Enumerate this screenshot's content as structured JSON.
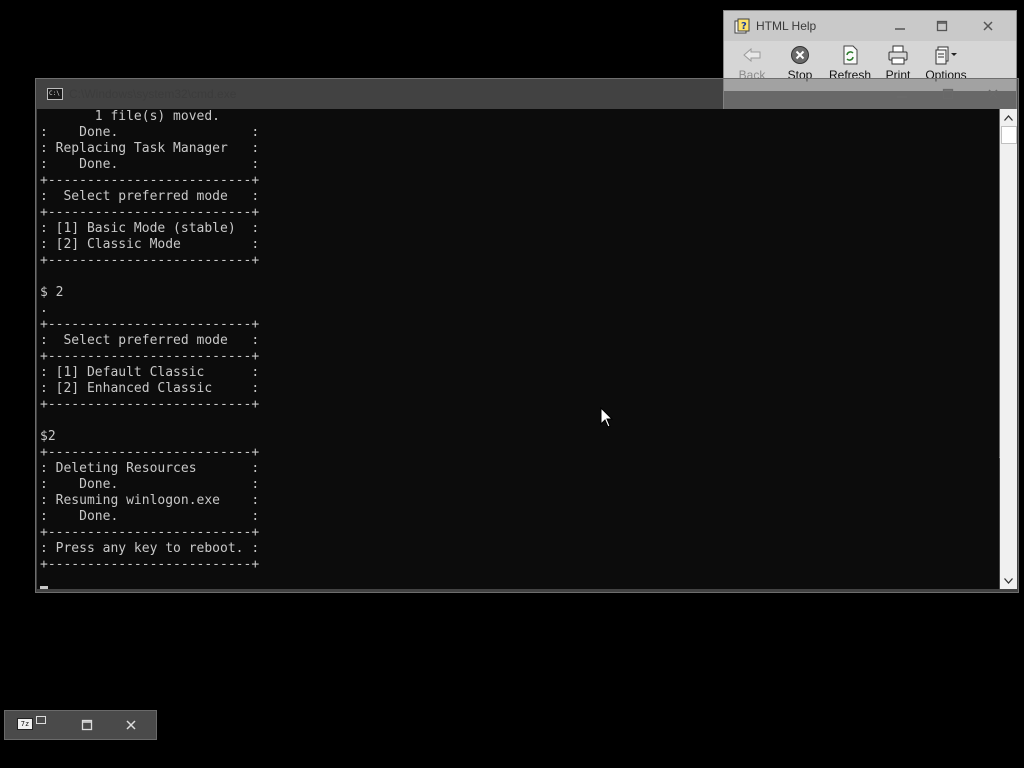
{
  "help_window": {
    "title": "HTML Help",
    "toolbar": [
      {
        "label": "Back",
        "icon": "back-arrow-icon",
        "enabled": false
      },
      {
        "label": "Stop",
        "icon": "stop-icon",
        "enabled": true
      },
      {
        "label": "Refresh",
        "icon": "refresh-icon",
        "enabled": true
      },
      {
        "label": "Print",
        "icon": "print-icon",
        "enabled": true
      },
      {
        "label": "Options",
        "icon": "options-icon",
        "enabled": true
      }
    ]
  },
  "cmd_window": {
    "title": "C:\\Windows\\system32\\cmd.exe",
    "console_lines": [
      "       1 file(s) moved.",
      ":    Done.                 :",
      ": Replacing Task Manager   :",
      ":    Done.                 :",
      "+--------------------------+",
      ":  Select preferred mode   :",
      "+--------------------------+",
      ": [1] Basic Mode (stable)  :",
      ": [2] Classic Mode         :",
      "+--------------------------+",
      "",
      "$ 2",
      ".",
      "+--------------------------+",
      ":  Select preferred mode   :",
      "+--------------------------+",
      ": [1] Default Classic      :",
      ": [2] Enhanced Classic     :",
      "+--------------------------+",
      "",
      "$2",
      "+--------------------------+",
      ": Deleting Resources       :",
      ":    Done.                 :",
      ": Resuming winlogon.exe    :",
      ":    Done.                 :",
      "+--------------------------+",
      ": Press any key to reboot. :",
      "+--------------------------+"
    ]
  },
  "colors": {
    "desktop": "#000000",
    "console_bg": "#0c0c0c",
    "console_fg": "#c8c8c8",
    "help_toolbar_bg": "#d6d6d6"
  }
}
